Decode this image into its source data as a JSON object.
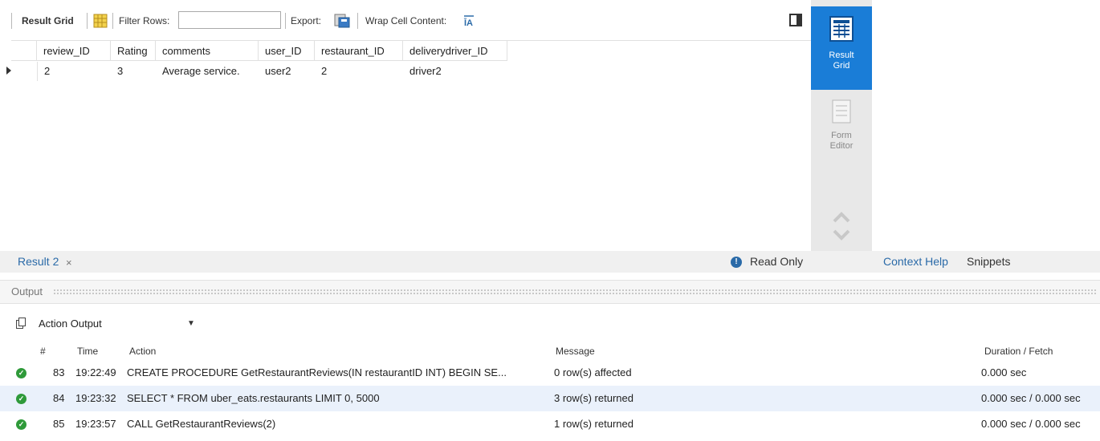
{
  "toolbar": {
    "result_grid_label": "Result Grid",
    "filter_rows_label": "Filter Rows:",
    "filter_value": "",
    "export_label": "Export:",
    "wrap_label": "Wrap Cell Content:"
  },
  "grid": {
    "columns": [
      "review_ID",
      "Rating",
      "comments",
      "user_ID",
      "restaurant_ID",
      "deliverydriver_ID"
    ],
    "rows": [
      [
        "2",
        "3",
        "Average service.",
        "user2",
        "2",
        "driver2"
      ]
    ]
  },
  "side_panel": {
    "result_grid": [
      "Result",
      "Grid"
    ],
    "form_editor": [
      "Form",
      "Editor"
    ]
  },
  "result_tab": {
    "label": "Result 2",
    "close": "×",
    "read_only": "Read Only",
    "info_glyph": "!"
  },
  "right_tabs": {
    "context_help": "Context Help",
    "snippets": "Snippets"
  },
  "output": {
    "title": "Output",
    "selector": "Action Output",
    "columns": {
      "num": "#",
      "time": "Time",
      "action": "Action",
      "message": "Message",
      "duration": "Duration / Fetch"
    },
    "rows": [
      {
        "num": "83",
        "time": "19:22:49",
        "action": "CREATE PROCEDURE GetRestaurantReviews(IN restaurantID INT) BEGIN    SE...",
        "message": "0 row(s) affected",
        "duration": "0.000 sec"
      },
      {
        "num": "84",
        "time": "19:23:32",
        "action": "SELECT * FROM uber_eats.restaurants LIMIT 0, 5000",
        "message": "3 row(s) returned",
        "duration": "0.000 sec / 0.000 sec"
      },
      {
        "num": "85",
        "time": "19:23:57",
        "action": "CALL GetRestaurantReviews(2)",
        "message": "1 row(s) returned",
        "duration": "0.000 sec / 0.000 sec"
      }
    ]
  },
  "colors": {
    "accent": "#1a7dd7",
    "success": "#2f9a3a",
    "selected_row": "#eaf1fb"
  },
  "icons": [
    "grid-icon",
    "export-icon",
    "wrap-icon",
    "panel-toggle-icon",
    "result-grid-icon",
    "form-editor-icon",
    "info-icon",
    "copy-icon",
    "check-icon"
  ]
}
